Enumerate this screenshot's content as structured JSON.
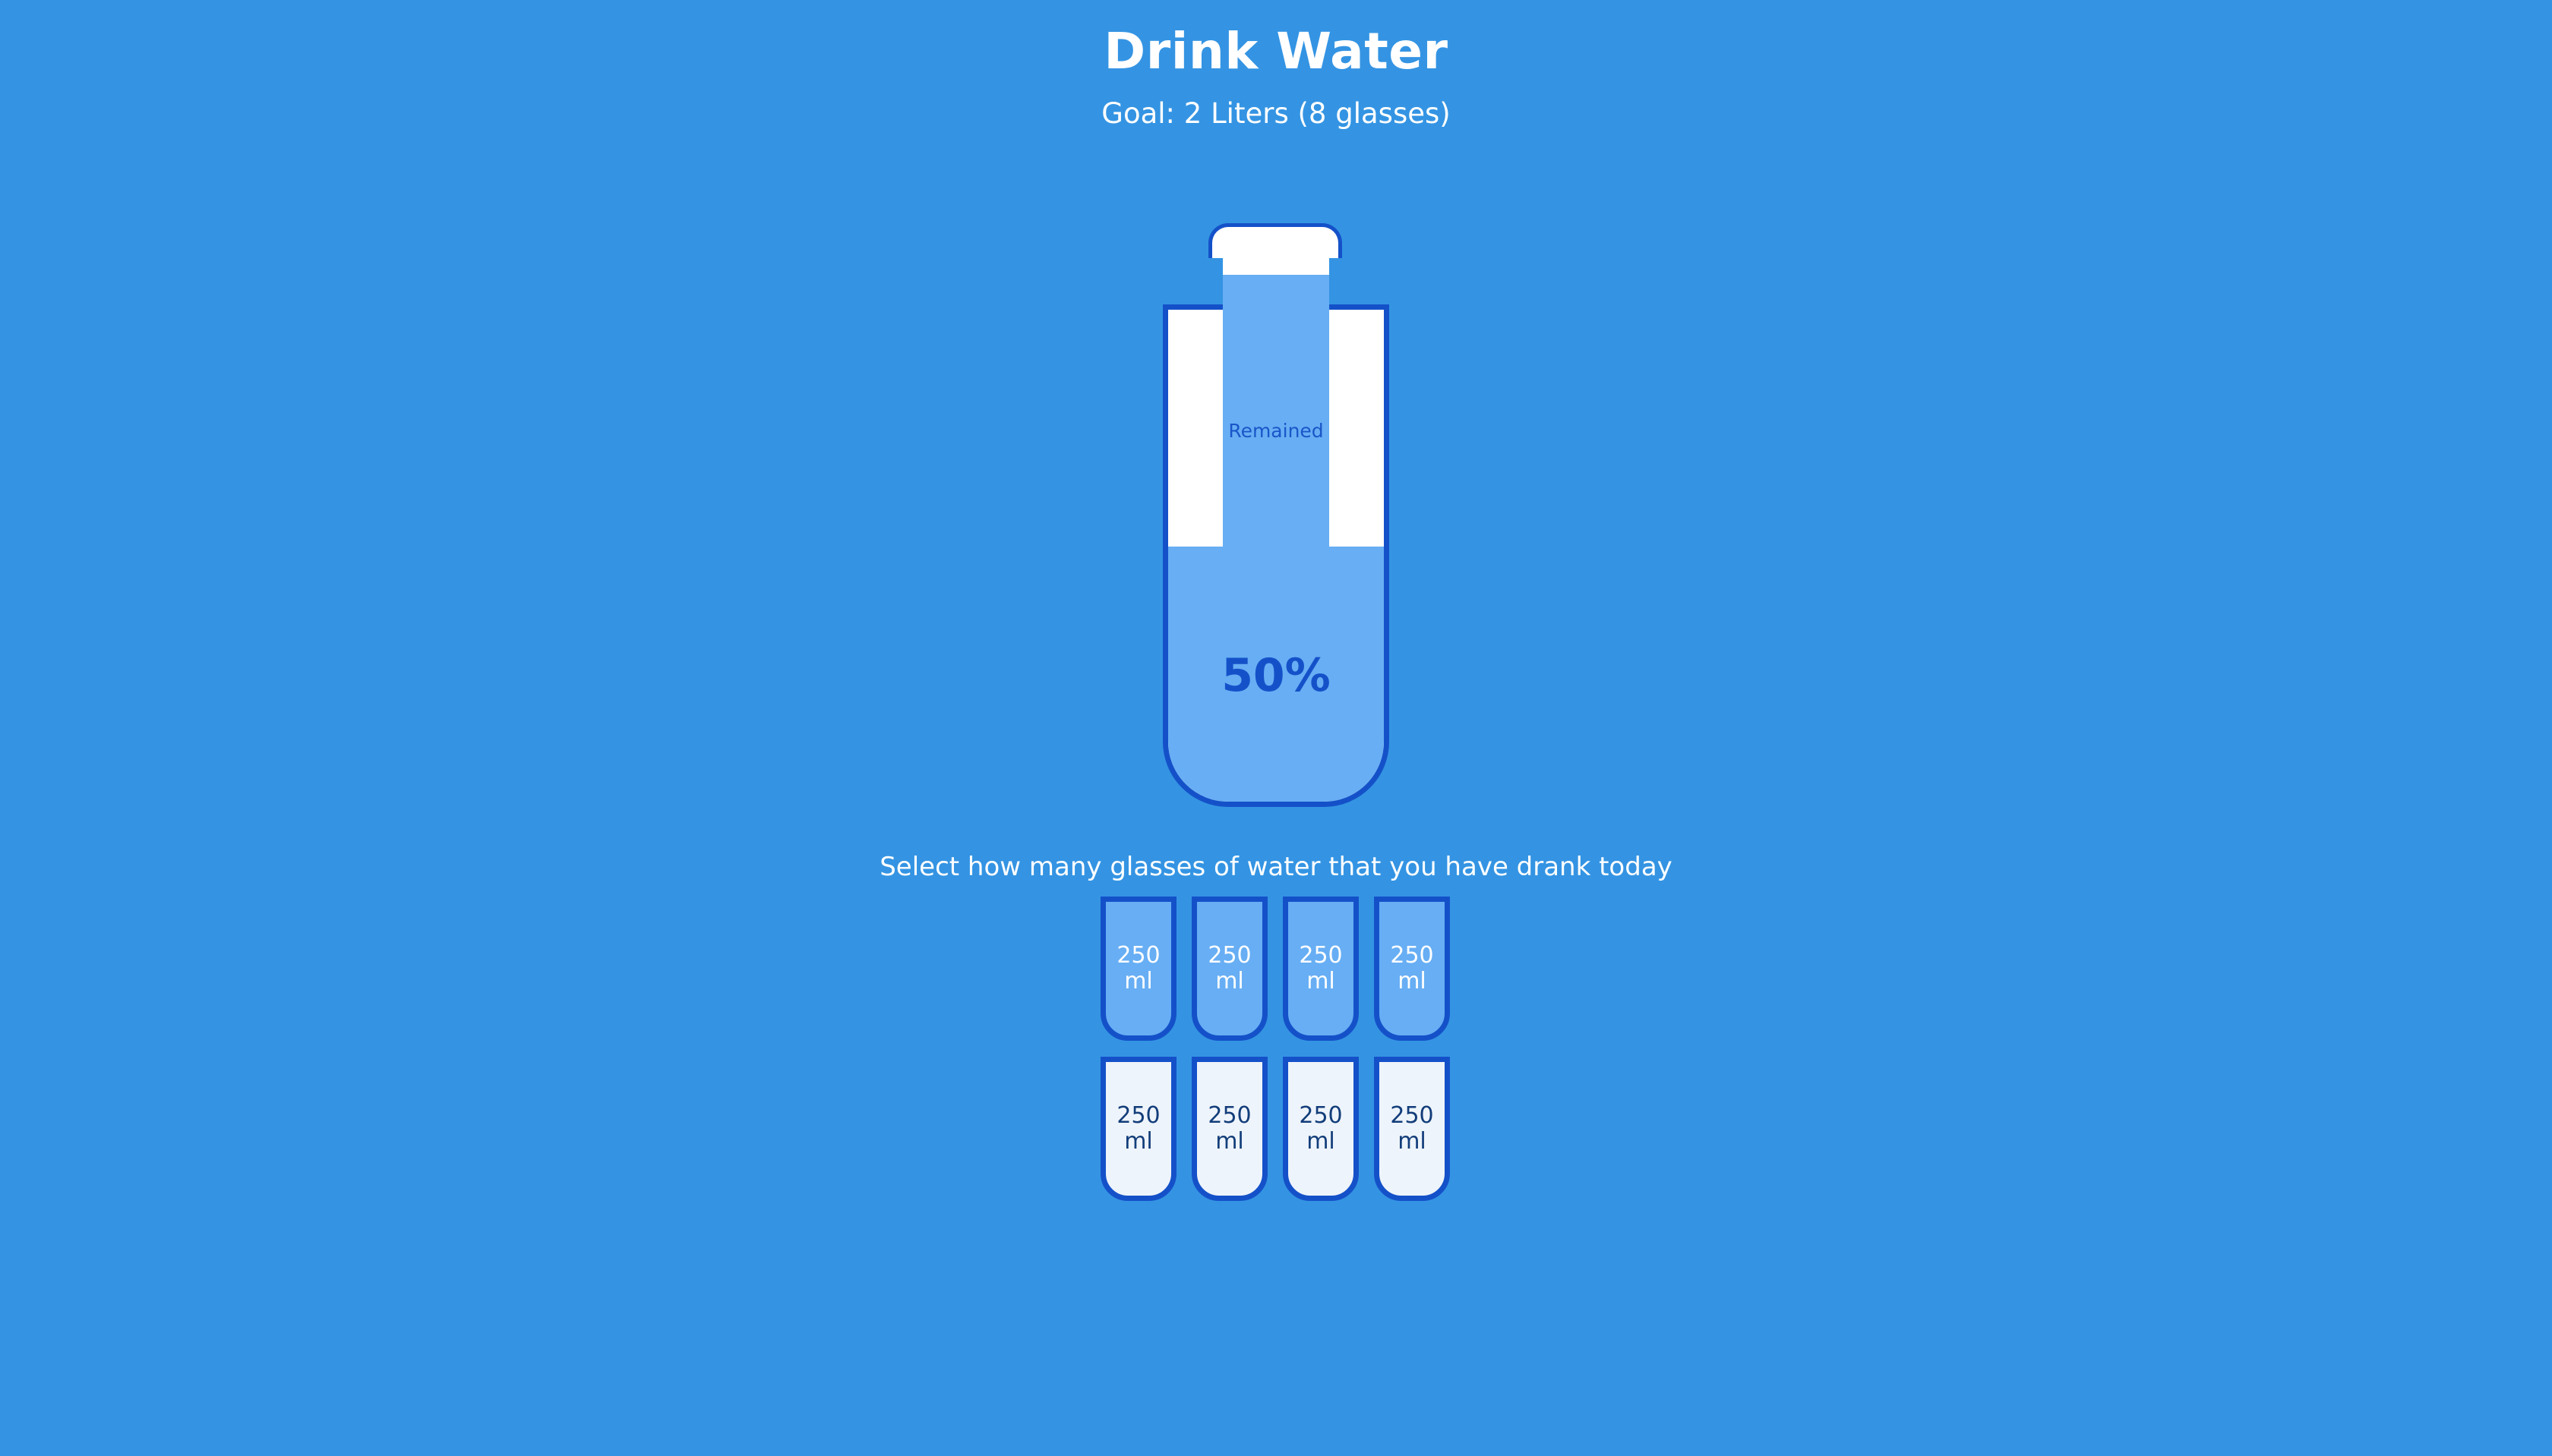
{
  "header": {
    "title": "Drink Water",
    "goal": "Goal: 2 Liters (8 glasses)"
  },
  "bottle": {
    "remained_label": "Remained",
    "percentage": "50%",
    "fill_fraction": 0.5,
    "colors": {
      "background": "#3494e3",
      "water": "#67aef4",
      "outline": "#1451c9"
    }
  },
  "instructions": "Select how many glasses of water that you have drank today",
  "cups": [
    {
      "amount": "250",
      "unit": "ml",
      "full": true
    },
    {
      "amount": "250",
      "unit": "ml",
      "full": true
    },
    {
      "amount": "250",
      "unit": "ml",
      "full": true
    },
    {
      "amount": "250",
      "unit": "ml",
      "full": true
    },
    {
      "amount": "250",
      "unit": "ml",
      "full": false
    },
    {
      "amount": "250",
      "unit": "ml",
      "full": false
    },
    {
      "amount": "250",
      "unit": "ml",
      "full": false
    },
    {
      "amount": "250",
      "unit": "ml",
      "full": false
    }
  ]
}
